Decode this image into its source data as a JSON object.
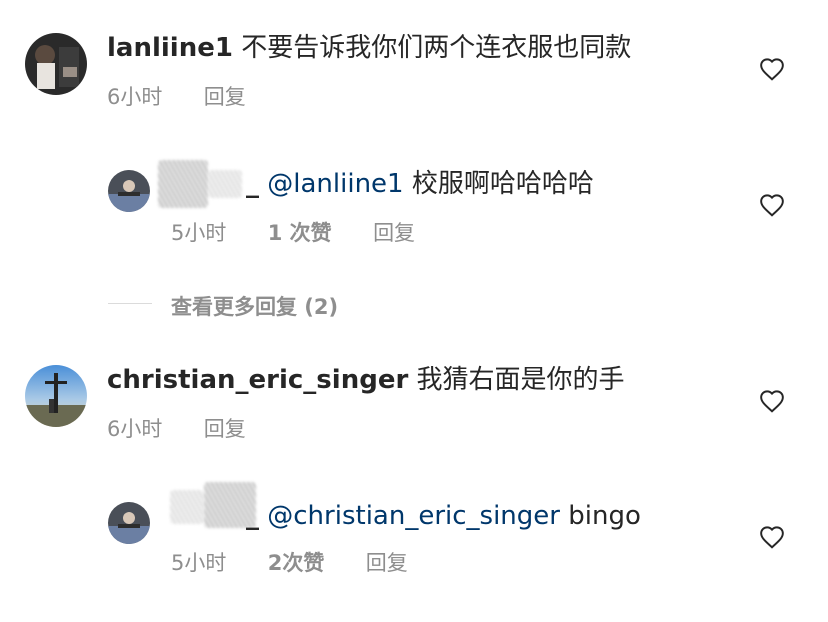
{
  "comments": [
    {
      "username": "lanliine1",
      "text": "不要告诉我你们两个连衣服也同款",
      "time": "6小时",
      "reply": "回复",
      "replies": [
        {
          "username_suffix": "_",
          "mention": "@lanliine1",
          "text": "校服啊哈哈哈哈",
          "time": "5小时",
          "likes": "1 次赞",
          "reply": "回复"
        }
      ],
      "view_more": "查看更多回复 (2)"
    },
    {
      "username": "christian_eric_singer",
      "text": "我猜右面是你的手",
      "time": "6小时",
      "reply": "回复",
      "replies": [
        {
          "username_suffix": "_",
          "mention": "@christian_eric_singer",
          "text": "bingo",
          "time": "5小时",
          "likes": "2次赞",
          "reply": "回复"
        }
      ]
    }
  ],
  "icons": {
    "like": "heart-outline-icon"
  },
  "colors": {
    "text": "#262626",
    "secondary": "#8e8e8e",
    "mention": "#00376b",
    "divider": "#dbdbdb"
  }
}
